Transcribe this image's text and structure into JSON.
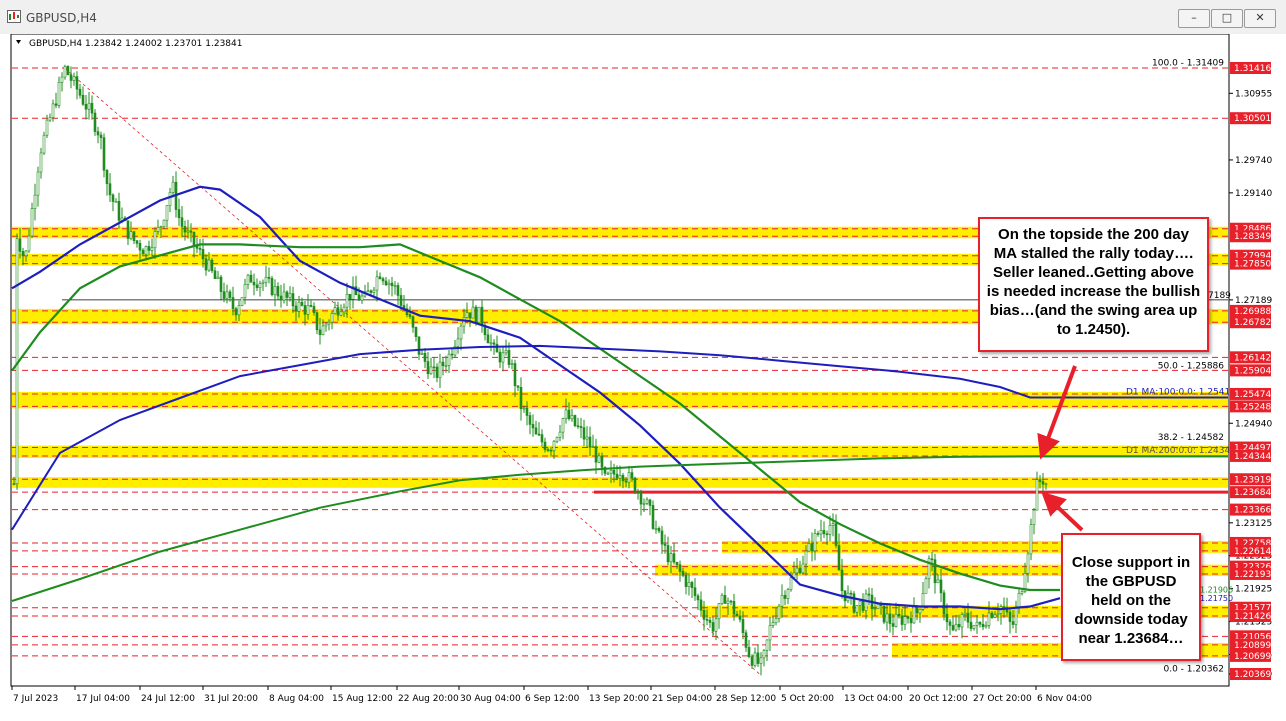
{
  "window": {
    "title": "GBPUSD,H4",
    "buttons": [
      "–",
      "□",
      "✕"
    ]
  },
  "chart_header": "GBPUSD,H4  1.23842 1.24002 1.23701 1.23841",
  "chart_data": {
    "type": "candlestick",
    "symbol": "GBPUSD",
    "timeframe": "H4",
    "ohlc_current": {
      "open": 1.23842,
      "high": 1.24002,
      "low": 1.23701,
      "close": 1.23841
    },
    "ylim": [
      1.203,
      1.3165
    ],
    "y_ticks": [
      "1.30955",
      "1.29740",
      "1.29140",
      "1.27189",
      "1.24940",
      "1.23125",
      "1.22525",
      "1.21925",
      "1.21325",
      "1.20725",
      "1.20369"
    ],
    "x_ticks": [
      "7 Jul 2023",
      "17 Jul 04:00",
      "24 Jul 12:00",
      "31 Jul 20:00",
      "8 Aug 04:00",
      "15 Aug 12:00",
      "22 Aug 20:00",
      "30 Aug 04:00",
      "6 Sep 12:00",
      "13 Sep 20:00",
      "21 Sep 04:00",
      "28 Sep 12:00",
      "5 Oct 20:00",
      "13 Oct 04:00",
      "20 Oct 12:00",
      "27 Oct 20:00",
      "6 Nov 04:00"
    ],
    "price_labels": [
      {
        "text": "1.31416",
        "value": 1.31416
      },
      {
        "text": "1.30501",
        "value": 1.30501
      },
      {
        "text": "1.28486",
        "value": 1.28486
      },
      {
        "text": "1.28349",
        "value": 1.28349
      },
      {
        "text": "1.27994",
        "value": 1.27994
      },
      {
        "text": "1.27850",
        "value": 1.2785
      },
      {
        "text": "1.26988",
        "value": 1.26988
      },
      {
        "text": "1.26782",
        "value": 1.26782
      },
      {
        "text": "1.26142",
        "value": 1.26142
      },
      {
        "text": "1.25904",
        "value": 1.25904
      },
      {
        "text": "1.25474",
        "value": 1.25474
      },
      {
        "text": "1.25248",
        "value": 1.25248
      },
      {
        "text": "1.24497",
        "value": 1.24497
      },
      {
        "text": "1.24344",
        "value": 1.24344
      },
      {
        "text": "1.23919",
        "value": 1.23919
      },
      {
        "text": "1.23684",
        "value": 1.23684
      },
      {
        "text": "1.23366",
        "value": 1.23366
      },
      {
        "text": "1.22758",
        "value": 1.22758
      },
      {
        "text": "1.22614",
        "value": 1.22614
      },
      {
        "text": "1.22326",
        "value": 1.22326
      },
      {
        "text": "1.22193",
        "value": 1.22193
      },
      {
        "text": "1.21577",
        "value": 1.21577
      },
      {
        "text": "1.21426",
        "value": 1.21426
      },
      {
        "text": "1.21056",
        "value": 1.21056
      },
      {
        "text": "1.20899",
        "value": 1.20899
      },
      {
        "text": "1.20699",
        "value": 1.20699
      },
      {
        "text": "1.20369",
        "value": 1.20369
      }
    ],
    "ma_labels": [
      {
        "text": "1.21906",
        "value": 1.21906,
        "color": "#1e8c1e"
      },
      {
        "text": "1.21750",
        "value": 1.2175,
        "color": "#1e1ebe"
      }
    ],
    "fib_labels": [
      {
        "text": "100.0 - 1.31409",
        "value": 1.31409
      },
      {
        "text": "50.0 - 1.25886",
        "value": 1.25886
      },
      {
        "text": "38.2 - 1.24582",
        "value": 1.24582
      },
      {
        "text": "0.0 - 1.20362",
        "value": 1.20362
      }
    ],
    "ma_line_labels": [
      {
        "text": "D1 MA:100:0.0: 1.25411",
        "value": 1.25411
      },
      {
        "text": "D1 MA:200:0.0: 1.24341",
        "value": 1.24341
      }
    ],
    "partial_level_text": "7189",
    "yellow_zones": [
      [
        1.28486,
        1.28349
      ],
      [
        1.27994,
        1.2785
      ],
      [
        1.26988,
        1.26782
      ],
      [
        1.25474,
        1.25248
      ],
      [
        1.24497,
        1.24344
      ],
      [
        1.23919,
        1.238
      ],
      [
        1.22758,
        1.22614
      ],
      [
        1.22326,
        1.22193
      ],
      [
        1.21577,
        1.21426
      ],
      [
        1.20899,
        1.20699
      ]
    ],
    "red_dashed_levels": [
      1.31416,
      1.30501,
      1.28486,
      1.28349,
      1.27994,
      1.2785,
      1.26988,
      1.26782,
      1.26142,
      1.25904,
      1.25474,
      1.25248,
      1.24497,
      1.24344,
      1.23919,
      1.23684,
      1.23366,
      1.22758,
      1.22614,
      1.22326,
      1.22193,
      1.21577,
      1.21426,
      1.21056,
      1.20899,
      1.20699
    ],
    "support_line": 1.23684,
    "colors": {
      "candle": "#1e8c1e",
      "ma_blue": "#1e1ebe",
      "ma_green": "#1e8c1e",
      "level": "#e8202a",
      "zone": "#ffee00",
      "label_bg": "#e8202a"
    }
  },
  "annotations": {
    "top_callout": "On the topside the 200 day MA stalled the rally today…. Seller leaned..Getting above is needed increase the bullish bias…(and the swing area up to 1.2450).",
    "bottom_callout": "Close support in the GBPUSD held on the downside today near 1.23684…"
  }
}
